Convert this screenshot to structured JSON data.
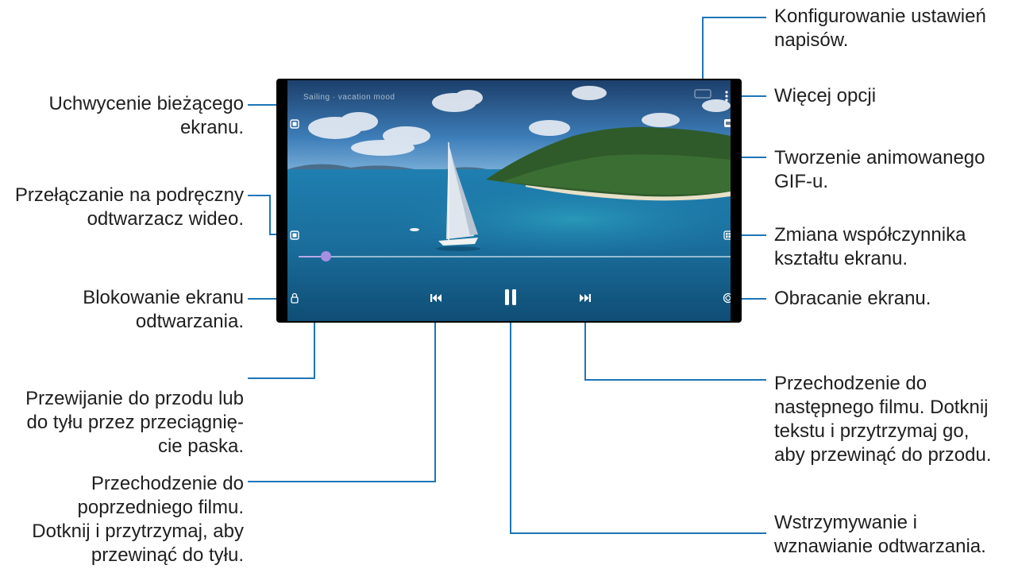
{
  "video_title": "Sailing · vacation mood",
  "player": {
    "progress_fraction": 0.06,
    "controls": {
      "subtitle_settings_icon": "subtitle-settings-icon",
      "more_options_icon": "more-vertical-icon",
      "screenshot_icon": "screenshot-icon",
      "gif_icon": "gif-icon",
      "popup_player_icon": "popup-player-icon",
      "aspect_ratio_icon": "aspect-ratio-icon",
      "lock_icon": "lock-icon",
      "rotate_icon": "rotate-icon",
      "previous_icon": "skip-previous-icon",
      "pause_icon": "pause-icon",
      "next_icon": "skip-next-icon"
    }
  },
  "callouts": {
    "subtitle_settings": "Konfigurowanie ustawień\nnapisów.",
    "more_options": "Więcej opcji",
    "create_gif": "Tworzenie animowanego\nGIF-u.",
    "aspect_ratio": "Zmiana współczynnika\nkształtu ekranu.",
    "rotate": "Obracanie ekranu.",
    "next": "Przechodzenie do\nnastępnego filmu. Dotknij\ntekstu i przytrzymaj go,\naby przewinąć do przodu.",
    "pause_resume": "Wstrzymywanie i\nwznawianie odtwarzania.",
    "screenshot": "Uchwycenie bieżącego\nekranu.",
    "popup_player": "Przełączanie na podręczny\nodtwarzacz wideo.",
    "lock": "Blokowanie ekranu\nodtwarzania.",
    "seek": "Przewijanie do przodu lub\ndo tyłu przez przeciągnię-\ncie paska.",
    "previous": "Przechodzenie do\npoprzedniego filmu.\nDotknij i przytrzymaj, aby\nprzewinąć do tyłu."
  },
  "colors": {
    "callout_line": "#1d75b8",
    "text": "#1f1f1f",
    "seek_thumb": "#a68fe0"
  }
}
